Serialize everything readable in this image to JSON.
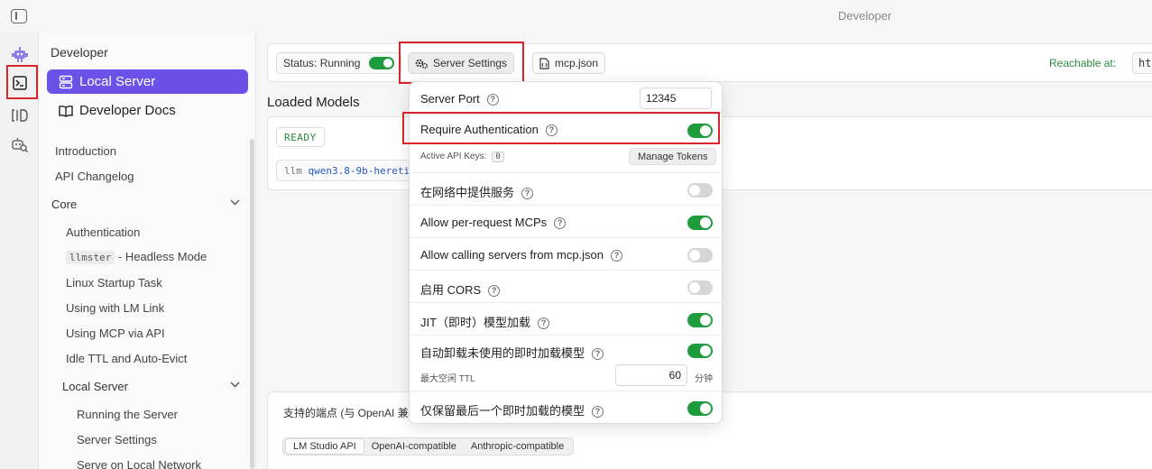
{
  "window": {
    "title": "Developer"
  },
  "sidebar": {
    "title": "Developer",
    "nav": [
      {
        "label": "Local Server"
      },
      {
        "label": "Developer Docs"
      }
    ],
    "docs": {
      "introduction": "Introduction",
      "api_changelog": "API Changelog",
      "core": "Core",
      "authentication": "Authentication",
      "llmster_code": "llmster",
      "llmster_text": "- Headless Mode",
      "linux_startup": "Linux Startup Task",
      "lm_link": "Using with LM Link",
      "mcp_via_api": "Using MCP via API",
      "idle_ttl": "Idle TTL and Auto-Evict",
      "local_server": "Local Server",
      "running_server": "Running the Server",
      "server_settings": "Server Settings",
      "serve_local": "Serve on Local Network"
    }
  },
  "toolbar": {
    "status_label": "Status: Running",
    "server_settings_label": "Server Settings",
    "mcp_json_label": "mcp.json",
    "reachable_label": "Reachable at:",
    "reachable_value": "http"
  },
  "loaded": {
    "title": "Loaded Models",
    "ready_badge": "READY",
    "cmd_prefix": "llm",
    "cmd_model": "qwen3.8-9b-hereti"
  },
  "endpoints": {
    "text": "支持的端点 (与 OpenAI 兼",
    "tabs": [
      "LM Studio API",
      "OpenAI-compatible",
      "Anthropic-compatible"
    ]
  },
  "settings": {
    "server_port_label": "Server Port",
    "server_port_value": "12345",
    "require_auth_label": "Require Authentication",
    "active_keys_label": "Active API Keys:",
    "active_keys_value": "0",
    "manage_tokens": "Manage Tokens",
    "serve_network_label": "在网络中提供服务",
    "per_request_mcps_label": "Allow per-request MCPs",
    "calling_servers_label": "Allow calling servers from mcp.json",
    "cors_label": "启用 CORS",
    "jit_label": "JIT（即时）模型加载",
    "auto_unload_label": "自动卸载未使用的即时加载模型",
    "max_idle_label": "最大空闲 TTL",
    "max_idle_value": "60",
    "max_idle_unit": "分钟",
    "keep_last_label": "仅保留最后一个即时加载的模型",
    "help": "?"
  },
  "colors": {
    "accent": "#6b51e8",
    "toggle_on": "#1e9b3d",
    "highlight": "#d6262b",
    "reachable": "#2b8a3e"
  },
  "icons": [
    "sidebar-toggle-icon",
    "robot-icon",
    "terminal-icon",
    "model-bracket-icon",
    "robot-search-icon",
    "server-icon",
    "book-icon",
    "gears-icon",
    "file-icon"
  ]
}
